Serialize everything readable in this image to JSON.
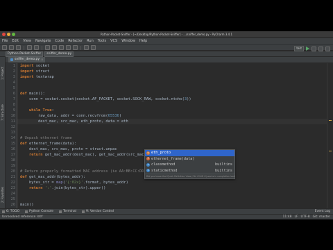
{
  "window": {
    "title": "Python-Packet-Sniffer - [~/Desktop/Python-Packet-Sniffer] - .../sniffer_demo.py - PyCharm 3.4.1"
  },
  "menu": [
    "File",
    "Edit",
    "View",
    "Navigate",
    "Code",
    "Refactor",
    "Run",
    "Tools",
    "VCS",
    "Window",
    "Help"
  ],
  "toolbar": {
    "run_config": "test",
    "run_icon": "play-icon"
  },
  "breadcrumbs": [
    "Python-Packet-Sniffer",
    "sniffer_demo.py"
  ],
  "side_tabs": {
    "project": "1: Project",
    "structure": "7: Structure",
    "favorites": "2: Favorites"
  },
  "editor_tab": {
    "file": "sniffer_demo.py"
  },
  "editor": {
    "line_numbers": [
      "1",
      "2",
      "3",
      "4",
      "5",
      "6",
      "7",
      "8",
      "9",
      "10",
      "11",
      "12",
      "13",
      "14",
      "15",
      "16",
      "17",
      "18",
      "19",
      "20",
      "21",
      "22",
      "23",
      "24",
      "25",
      "26",
      "27"
    ],
    "lines": [
      "import socket",
      "import struct",
      "import textwrap",
      "",
      "",
      "def main():",
      "    conn = socket.socket(socket.AF_PACKET, socket.SOCK_RAW, socket.ntohs(3))",
      "",
      "    while True:",
      "        raw_data, addr = conn.recvfrom(65536)",
      "        dest_mac, src_mac, eth_proto, data = eth",
      "",
      "",
      "# Unpack ethernet frame",
      "def ethernet_frame(data):",
      "    dest_mac, src_mac, proto = struct.unpac",
      "    return get_mac_addr(dest_mac), get_mac_addr(src_mac), socket.htons(proto), data[14:]",
      "",
      "",
      "# Return properly formatted MAC address (ie AA:BB:CC:DD:EE:FF)",
      "def get_mac_addr(bytes_addr):",
      "    bytes_str = map('{:02x}'.format, bytes_addr)",
      "    return ':'.join(bytes_str).upper()",
      "",
      "",
      "main()",
      ""
    ]
  },
  "autocomplete": {
    "items": [
      {
        "name": "eth_proto",
        "type": "",
        "icon": "variable-icon"
      },
      {
        "name": "ethernet_frame(data)",
        "type": "",
        "icon": "function-icon"
      },
      {
        "name": "classmethod",
        "type": "builtins",
        "icon": "class-icon"
      },
      {
        "name": "staticmethod",
        "type": "builtins",
        "icon": "class-icon"
      }
    ],
    "footer": "Did you know that Quick Definition View (Ctrl+Shift+I) works in completion lookups as well?"
  },
  "bottom_tools": [
    "6: TODO",
    "Python Console",
    "Terminal",
    "9: Version Control"
  ],
  "bottom_right": "Event Log",
  "status": {
    "left": "Unresolved reference 'eth'",
    "position": "11:48",
    "line_sep": "LF",
    "encoding": "UTF-8",
    "vcs": "Git: master"
  },
  "colors": {
    "background": "#2b2b2b",
    "keyword": "#cc7832",
    "function": "#ffc66d",
    "number": "#6897bb",
    "string": "#6a8759",
    "comment": "#808080",
    "selection": "#2f65ca"
  }
}
